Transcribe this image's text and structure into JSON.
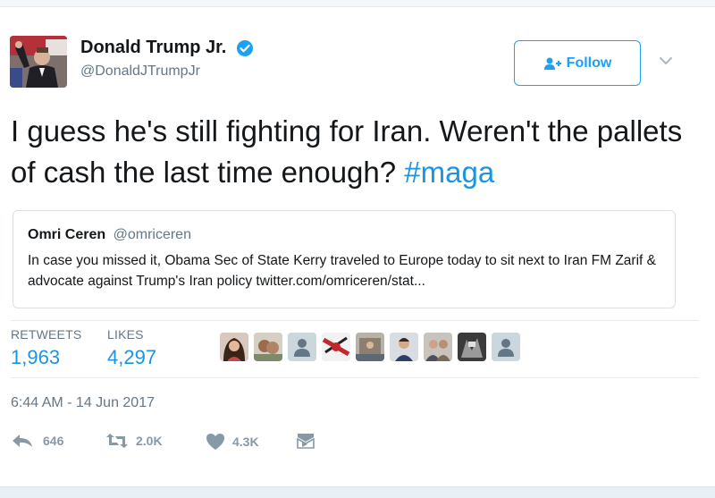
{
  "author": {
    "display_name": "Donald Trump Jr.",
    "screen_name": "@DonaldJTrumpJr",
    "verified": true
  },
  "follow_button": {
    "label": "Follow",
    "icon": "add-user-icon"
  },
  "tweet": {
    "text": "I guess he's still fighting for Iran. Weren't the pallets of cash the last time enough? ",
    "hashtag": "#maga"
  },
  "quote": {
    "name": "Omri Ceren",
    "handle": "@omriceren",
    "text": "In case you missed it, Obama Sec of State Kerry traveled to Europe today to sit next to Iran FM Zarif & advocate against Trump's Iran policy twitter.com/omriceren/stat..."
  },
  "stats": {
    "retweets_label": "RETWEETS",
    "retweets_value": "1,963",
    "likes_label": "LIKES",
    "likes_value": "4,297"
  },
  "timestamp": "6:44 AM - 14 Jun 2017",
  "actions": {
    "reply_count": "646",
    "retweet_count": "2.0K",
    "like_count": "4.3K"
  },
  "colors": {
    "accent": "#1da1f2",
    "link": "#1b95e0",
    "muted": "#657786",
    "action_gray": "#8899a6"
  }
}
